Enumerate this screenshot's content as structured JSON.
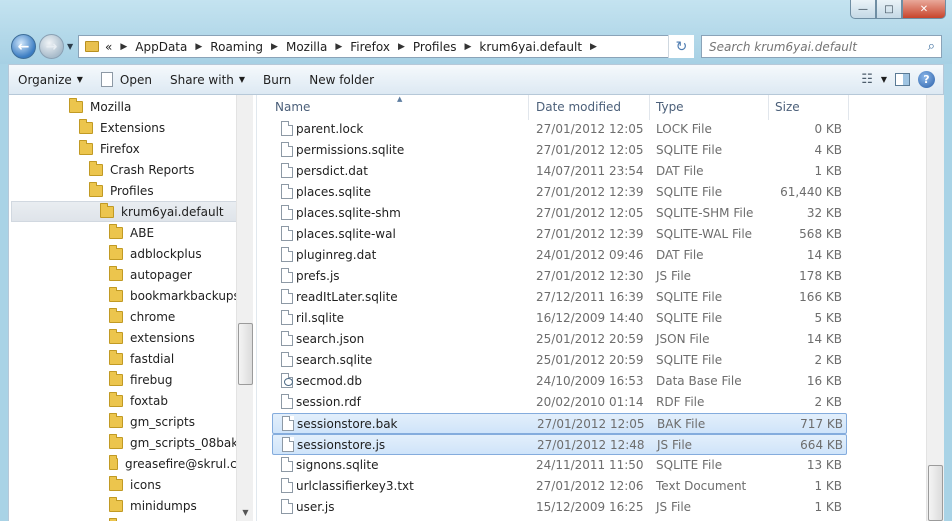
{
  "window": {
    "minimize_glyph": "—",
    "maximize_glyph": "□",
    "close_glyph": "✕",
    "accent": "#a9d3e6"
  },
  "nav": {
    "back_glyph": "←",
    "forward_glyph": "→",
    "history_glyph": "▼",
    "refresh_glyph": "↻"
  },
  "address": {
    "overflow": "«",
    "crumbs": [
      "AppData",
      "Roaming",
      "Mozilla",
      "Firefox",
      "Profiles",
      "krum6yai.default"
    ],
    "dropdown_glyph": "▼"
  },
  "search": {
    "placeholder": "Search krum6yai.default",
    "icon": "search-icon"
  },
  "toolbar": {
    "organize": "Organize",
    "open": "Open",
    "share_with": "Share with",
    "burn": "Burn",
    "new_folder": "New folder"
  },
  "tree": {
    "items": [
      {
        "label": "Mozilla",
        "indent": 0
      },
      {
        "label": "Extensions",
        "indent": 1
      },
      {
        "label": "Firefox",
        "indent": 1
      },
      {
        "label": "Crash Reports",
        "indent": 2
      },
      {
        "label": "Profiles",
        "indent": 2
      },
      {
        "label": "krum6yai.default",
        "indent": 3,
        "selected": true
      },
      {
        "label": "ABE",
        "indent": 4
      },
      {
        "label": "adblockplus",
        "indent": 4
      },
      {
        "label": "autopager",
        "indent": 4
      },
      {
        "label": "bookmarkbackups",
        "indent": 4
      },
      {
        "label": "chrome",
        "indent": 4
      },
      {
        "label": "extensions",
        "indent": 4
      },
      {
        "label": "fastdial",
        "indent": 4
      },
      {
        "label": "firebug",
        "indent": 4
      },
      {
        "label": "foxtab",
        "indent": 4
      },
      {
        "label": "gm_scripts",
        "indent": 4
      },
      {
        "label": "gm_scripts_08bak",
        "indent": 4
      },
      {
        "label": "greasefire@skrul.cor",
        "indent": 4
      },
      {
        "label": "icons",
        "indent": 4
      },
      {
        "label": "minidumps",
        "indent": 4
      },
      {
        "label": "",
        "indent": 4
      }
    ]
  },
  "columns": {
    "name": "Name",
    "date": "Date modified",
    "type": "Type",
    "size": "Size"
  },
  "files": [
    {
      "name": "parent.lock",
      "date": "27/01/2012 12:05",
      "type": "LOCK File",
      "size": "0 KB"
    },
    {
      "name": "permissions.sqlite",
      "date": "27/01/2012 12:05",
      "type": "SQLITE File",
      "size": "4 KB"
    },
    {
      "name": "persdict.dat",
      "date": "14/07/2011 23:54",
      "type": "DAT File",
      "size": "1 KB"
    },
    {
      "name": "places.sqlite",
      "date": "27/01/2012 12:39",
      "type": "SQLITE File",
      "size": "61,440 KB"
    },
    {
      "name": "places.sqlite-shm",
      "date": "27/01/2012 12:05",
      "type": "SQLITE-SHM File",
      "size": "32 KB"
    },
    {
      "name": "places.sqlite-wal",
      "date": "27/01/2012 12:39",
      "type": "SQLITE-WAL File",
      "size": "568 KB"
    },
    {
      "name": "pluginreg.dat",
      "date": "24/01/2012 09:46",
      "type": "DAT File",
      "size": "14 KB"
    },
    {
      "name": "prefs.js",
      "date": "27/01/2012 12:30",
      "type": "JS File",
      "size": "178 KB"
    },
    {
      "name": "readItLater.sqlite",
      "date": "27/12/2011 16:39",
      "type": "SQLITE File",
      "size": "166 KB"
    },
    {
      "name": "ril.sqlite",
      "date": "16/12/2009 14:40",
      "type": "SQLITE File",
      "size": "5 KB"
    },
    {
      "name": "search.json",
      "date": "25/01/2012 20:59",
      "type": "JSON File",
      "size": "14 KB"
    },
    {
      "name": "search.sqlite",
      "date": "25/01/2012 20:59",
      "type": "SQLITE File",
      "size": "2 KB"
    },
    {
      "name": "secmod.db",
      "date": "24/10/2009 16:53",
      "type": "Data Base File",
      "size": "16 KB",
      "icon": "db"
    },
    {
      "name": "session.rdf",
      "date": "20/02/2010 01:14",
      "type": "RDF File",
      "size": "2 KB"
    },
    {
      "name": "sessionstore.bak",
      "date": "27/01/2012 12:05",
      "type": "BAK File",
      "size": "717 KB",
      "selected": true
    },
    {
      "name": "sessionstore.js",
      "date": "27/01/2012 12:48",
      "type": "JS File",
      "size": "664 KB",
      "selected": true
    },
    {
      "name": "signons.sqlite",
      "date": "24/11/2011 11:50",
      "type": "SQLITE File",
      "size": "13 KB"
    },
    {
      "name": "urlclassifierkey3.txt",
      "date": "27/01/2012 12:06",
      "type": "Text Document",
      "size": "1 KB"
    },
    {
      "name": "user.js",
      "date": "15/12/2009 16:25",
      "type": "JS File",
      "size": "1 KB"
    }
  ]
}
